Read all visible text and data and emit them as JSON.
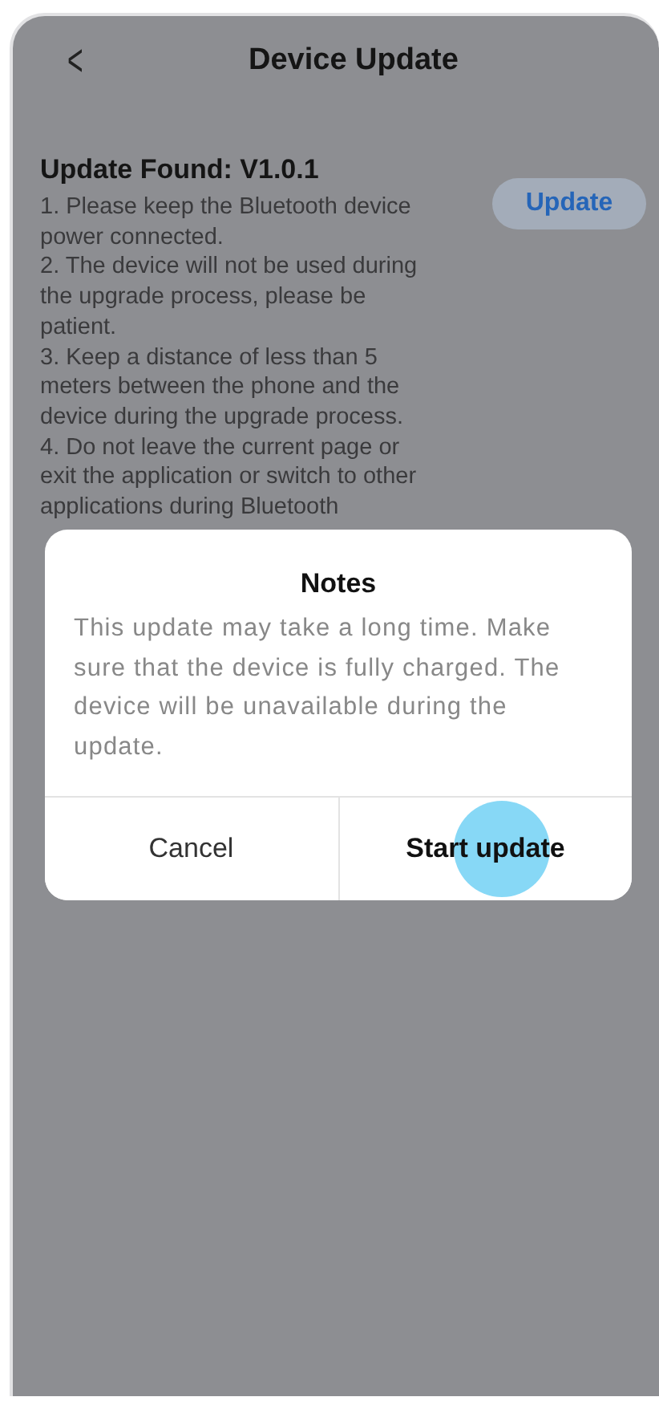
{
  "header": {
    "back_icon": "<",
    "title": "Device Update"
  },
  "update": {
    "title": "Update Found: V1.0.1",
    "button": "Update",
    "instructions": [
      "1. Please keep the Bluetooth device power connected.",
      "2. The device will not be used during the upgrade process, please be patient.",
      "3. Keep a distance of less than 5 meters between the phone and the device during the upgrade process.",
      "4. Do not leave the current page or exit the application or switch to other applications during Bluetooth"
    ]
  },
  "dialog": {
    "title": "Notes",
    "message": "This update may take a long time. Make sure that the device is fully charged. The device will be unavailable during the update.",
    "buttons": [
      {
        "label": "Cancel",
        "kind": "secondary"
      },
      {
        "label": "Start update",
        "kind": "primary"
      }
    ]
  }
}
